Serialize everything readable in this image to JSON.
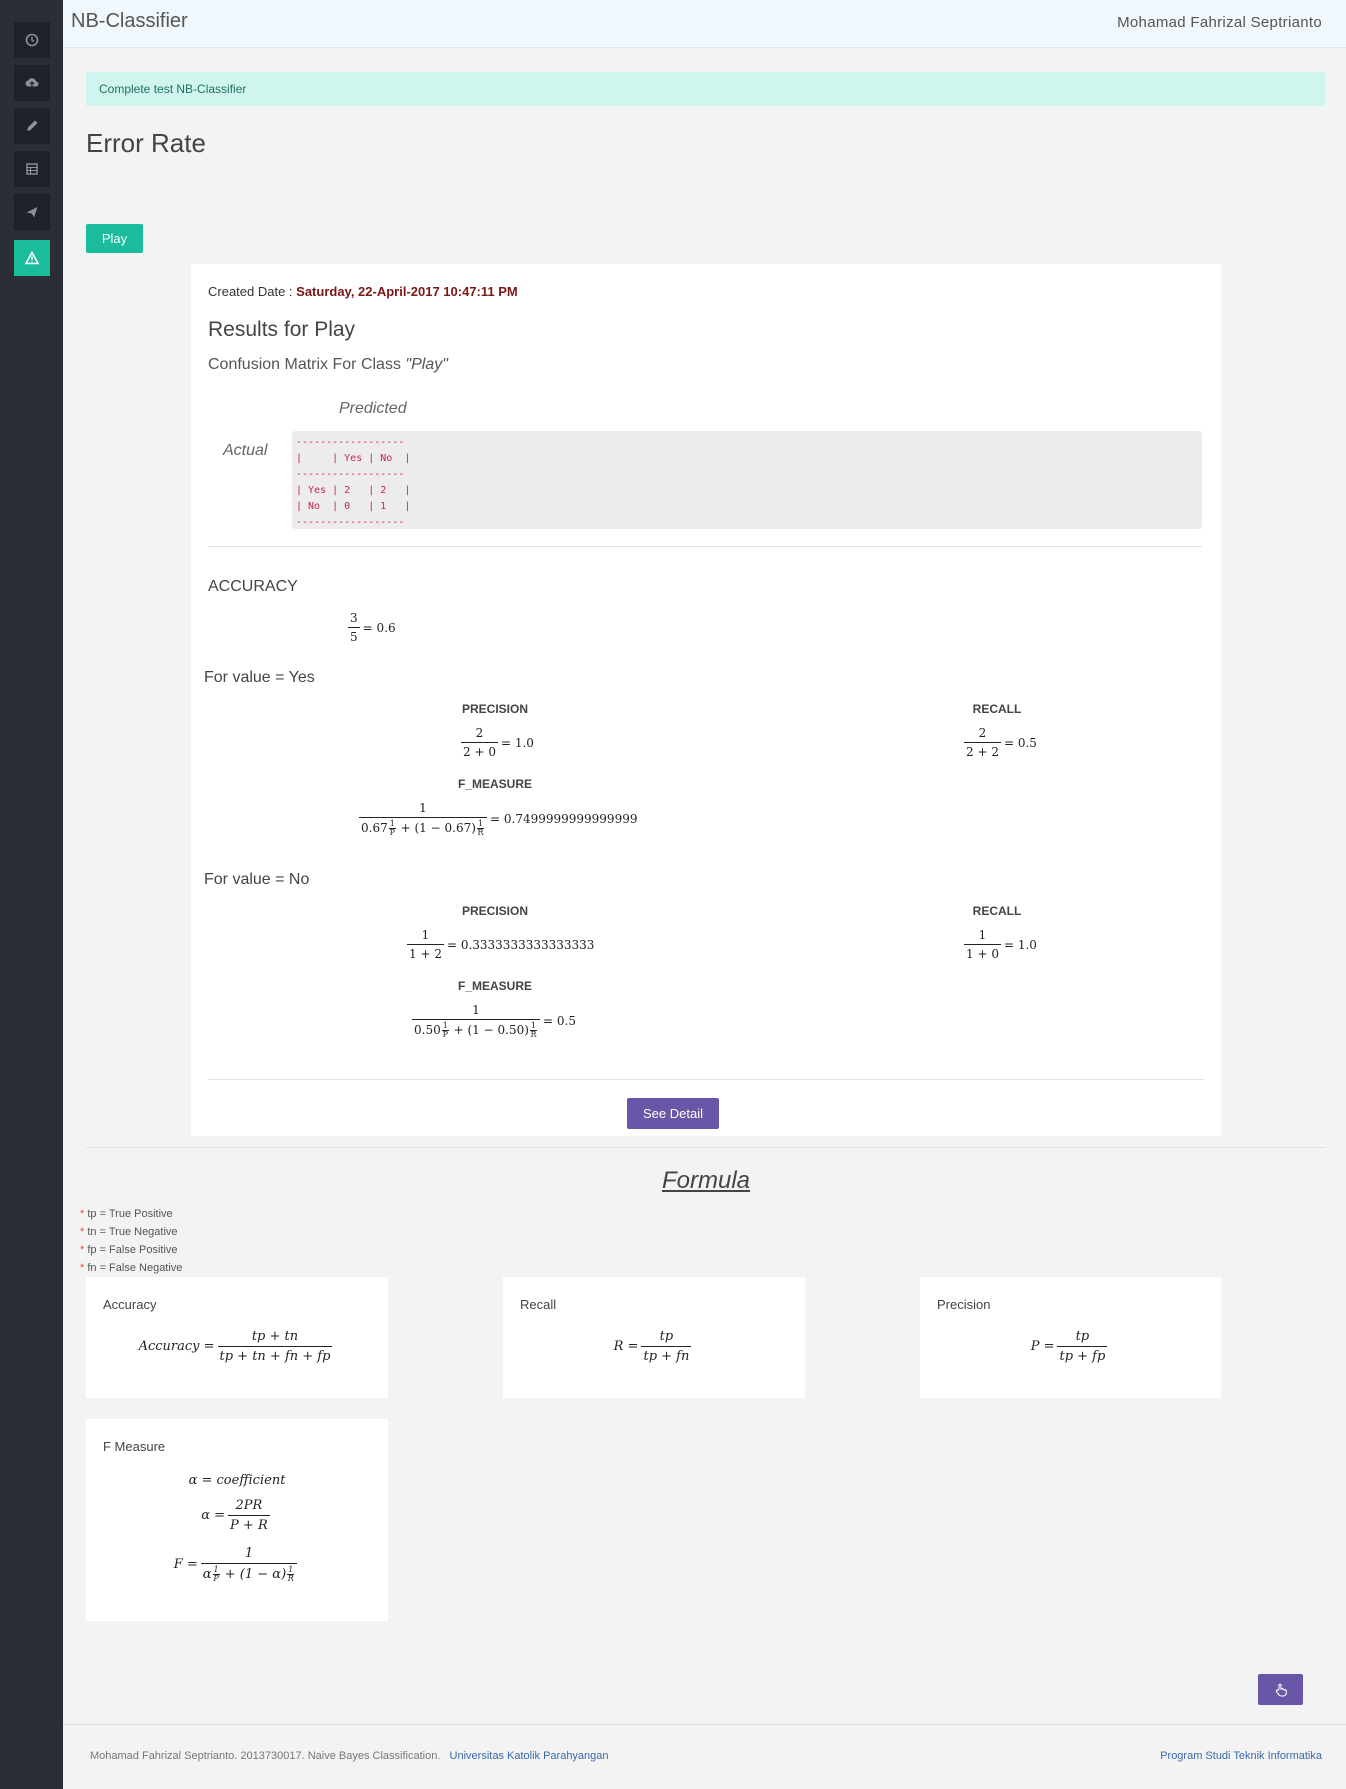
{
  "header": {
    "brand": "NB-Classifier",
    "user": "Mohamad Fahrizal Septrianto"
  },
  "sidebar": {
    "items": [
      {
        "icon": "dashboard-icon"
      },
      {
        "icon": "upload-cloud-icon"
      },
      {
        "icon": "pencil-icon"
      },
      {
        "icon": "table-icon"
      },
      {
        "icon": "send-icon"
      },
      {
        "icon": "warning-icon",
        "active": true
      }
    ]
  },
  "alert": "Complete test NB-Classifier",
  "page_title": "Error Rate",
  "play_button": "Play",
  "result": {
    "created_label": "Created Date : ",
    "created_value": "Saturday, 22-April-2017 10:47:11 PM",
    "title": "Results for Play",
    "cm_title_prefix": "Confusion Matrix For Class ",
    "cm_class": "\"Play\"",
    "predicted": "Predicted",
    "actual": "Actual",
    "matrix": "------------------\n|     | Yes | No  |\n------------------\n| Yes | 2   | 2   |\n| No  | 0   | 1   |\n------------------",
    "accuracy_label": "ACCURACY",
    "accuracy": {
      "num": "3",
      "den": "5",
      "result": "= 0.6"
    },
    "yes": {
      "label": "For value = Yes",
      "precision_label": "PRECISION",
      "precision": {
        "num": "2",
        "den": "2 + 0",
        "result": "= 1.0"
      },
      "recall_label": "RECALL",
      "recall": {
        "num": "2",
        "den": "2 + 2",
        "result": "= 0.5"
      },
      "f_label": "F_MEASURE",
      "f": {
        "num": "1",
        "coef": "0.67",
        "coef2": "(1 − 0.67)",
        "result": "= 0.7499999999999999"
      }
    },
    "no": {
      "label": "For value = No",
      "precision_label": "PRECISION",
      "precision": {
        "num": "1",
        "den": "1 + 2",
        "result": "= 0.3333333333333333"
      },
      "recall_label": "RECALL",
      "recall": {
        "num": "1",
        "den": "1 + 0",
        "result": "= 1.0"
      },
      "f_label": "F_MEASURE",
      "f": {
        "num": "1",
        "coef": "0.50",
        "coef2": "(1 − 0.50)",
        "result": "= 0.5"
      }
    },
    "see_detail": "See Detail"
  },
  "formula": {
    "title": "Formula",
    "legend": [
      "tp = True Positive",
      "tn = True Negative",
      "fp = False Positive",
      "fn = False Negative"
    ],
    "accuracy_title": "Accuracy",
    "accuracy_lhs": "Accuracy =",
    "accuracy_num": "tp + tn",
    "accuracy_den": "tp + tn + fn + fp",
    "recall_title": "Recall",
    "recall_lhs": "R =",
    "recall_num": "tp",
    "recall_den": "tp + fn",
    "precision_title": "Precision",
    "precision_lhs": "P =",
    "precision_num": "tp",
    "precision_den": "tp + fp",
    "fmeasure_title": "F Measure",
    "f_line1": "α = coefficient",
    "f_alpha_lhs": "α =",
    "f_alpha_num": "2PR",
    "f_alpha_den": "P + R",
    "f_lhs": "F =",
    "f_num": "1",
    "f_den_alpha": "α",
    "f_den_mid": "+ (1 − α)"
  },
  "footer": {
    "name": "Mohamad Fahrizal Septrianto. 2013730017. Naive Bayes Classification.",
    "university": "Universitas Katolik Parahyangan",
    "program": "Program Studi Teknik Informatika"
  }
}
